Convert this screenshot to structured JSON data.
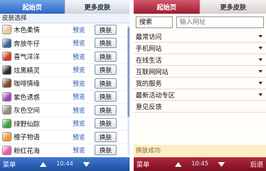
{
  "left": {
    "tabs": {
      "home": "起始页",
      "more_skins": "更多皮肤"
    },
    "section_title": "皮肤选择",
    "preview_label": "预览",
    "change_label": "换肤",
    "skins": [
      {
        "name": "木色柔情",
        "color": "#e8c89a"
      },
      {
        "name": "奔放牛仔",
        "color": "#3a5f9a"
      },
      {
        "name": "喜气洋洋",
        "color": "#d63a2a"
      },
      {
        "name": "炫黑精灵",
        "color": "#2a2a2a"
      },
      {
        "name": "咖啡情缘",
        "color": "#7a4a2a"
      },
      {
        "name": "紫色诱惑",
        "color": "#9a4ab8"
      },
      {
        "name": "灰色空间",
        "color": "#8a8a8a"
      },
      {
        "name": "绿野仙踪",
        "color": "#3aa03a"
      },
      {
        "name": "橙子物语",
        "color": "#f09a2a"
      },
      {
        "name": "粉红花海",
        "color": "#e85aa0"
      }
    ],
    "softkeys": {
      "left": "菜单",
      "time": "10:44"
    }
  },
  "right": {
    "tabs": {
      "home": "起始页",
      "more_skins": "更多皮肤"
    },
    "search_label": "搜索",
    "url_placeholder": "输入网址",
    "menu": [
      {
        "label": "最常访问",
        "has_arrow": true
      },
      {
        "label": "手机网站",
        "has_arrow": true
      },
      {
        "label": "在线生活",
        "has_arrow": true
      },
      {
        "label": "互联网网站",
        "has_arrow": true
      },
      {
        "label": "我的服务",
        "has_arrow": true
      },
      {
        "label": "最新活动专区",
        "has_arrow": true
      },
      {
        "label": "意见反馈",
        "has_arrow": false
      }
    ],
    "status": "换肤成功",
    "softkeys": {
      "left": "菜单",
      "time": "10:45",
      "right": "后退"
    }
  },
  "colors": {
    "blue_accent": "#2f66c4",
    "red_accent": "#9c1c30",
    "status_bg": "#fbeec7"
  }
}
